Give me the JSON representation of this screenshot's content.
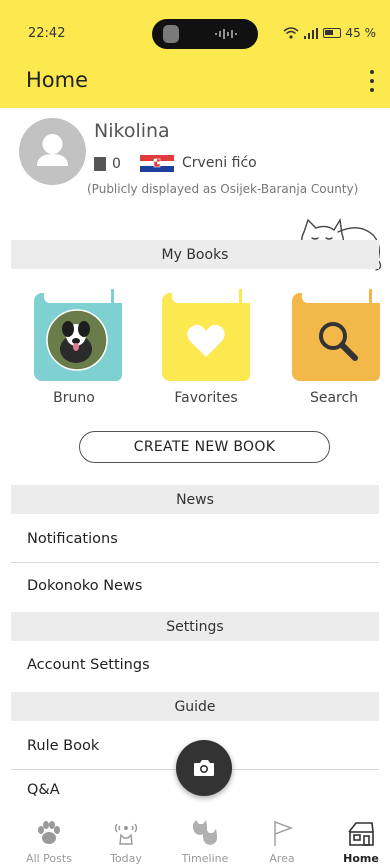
{
  "status_bar": {
    "time": "22:42",
    "battery": "45 %"
  },
  "header": {
    "title": "Home"
  },
  "profile": {
    "name": "Nikolina",
    "book_count": "0",
    "team": "Crveni fićo",
    "public_note": "(Publicly displayed as Osijek-Baranja County)"
  },
  "sections": {
    "my_books": "My Books",
    "news": "News",
    "settings": "Settings",
    "guide": "Guide"
  },
  "books": [
    {
      "label": "Bruno",
      "color": "#7fd0d0"
    },
    {
      "label": "Favorites",
      "color": "#fbe94f"
    },
    {
      "label": "Search",
      "color": "#f2b84a"
    }
  ],
  "create_button": "CREATE NEW BOOK",
  "news_items": [
    "Notifications",
    "Dokonoko News"
  ],
  "settings_items": [
    "Account Settings"
  ],
  "guide_items": [
    "Rule Book",
    "Q&A"
  ],
  "bottom_nav": [
    {
      "label": "All Posts",
      "icon": "paw-icon"
    },
    {
      "label": "Today",
      "icon": "cat-signal-icon"
    },
    {
      "label": "Timeline",
      "icon": "cat-faces-icon"
    },
    {
      "label": "Area",
      "icon": "flag-icon"
    },
    {
      "label": "Home",
      "icon": "house-icon",
      "active": true
    }
  ],
  "colors": {
    "brand_yellow": "#fbe94f",
    "section_gray": "#ececec",
    "fab": "#333333"
  }
}
